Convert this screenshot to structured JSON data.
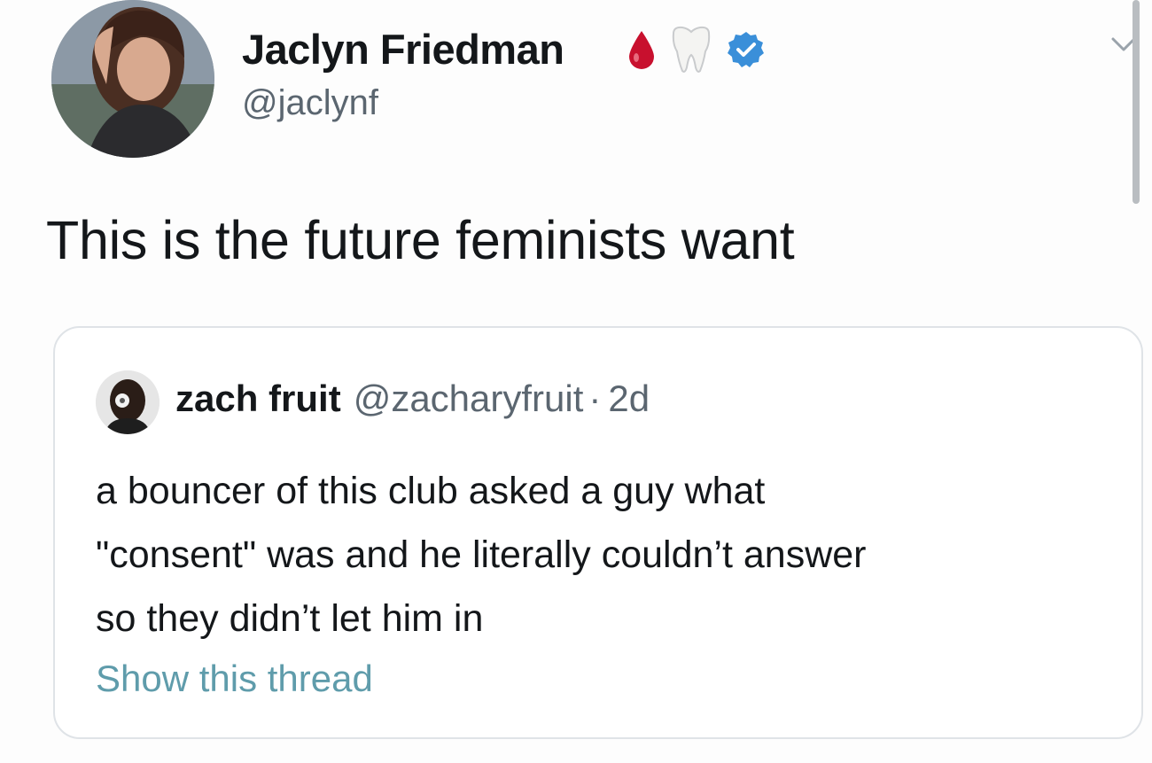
{
  "tweet": {
    "author_name": "Jaclyn Friedman",
    "author_handle": "@jaclynf",
    "name_icons": [
      "blood-drop-icon",
      "tooth-icon",
      "verified-badge-icon"
    ],
    "text": "This is the future feminists want"
  },
  "quoted_tweet": {
    "author_name": "zach fruit",
    "author_handle": "@zacharyfruit",
    "separator": "·",
    "time": "2d",
    "text_lines": [
      "a bouncer of this club asked a guy what",
      "\"consent\" was and he literally couldn’t answer",
      "so they didn’t let him in"
    ],
    "show_thread_label": "Show this thread"
  },
  "colors": {
    "text": "#14171a",
    "secondary_text": "#5b6670",
    "link": "#5f9cab",
    "verified": "#3a8fd9",
    "blood": "#c8102e",
    "card_border": "#dfe3e7"
  }
}
